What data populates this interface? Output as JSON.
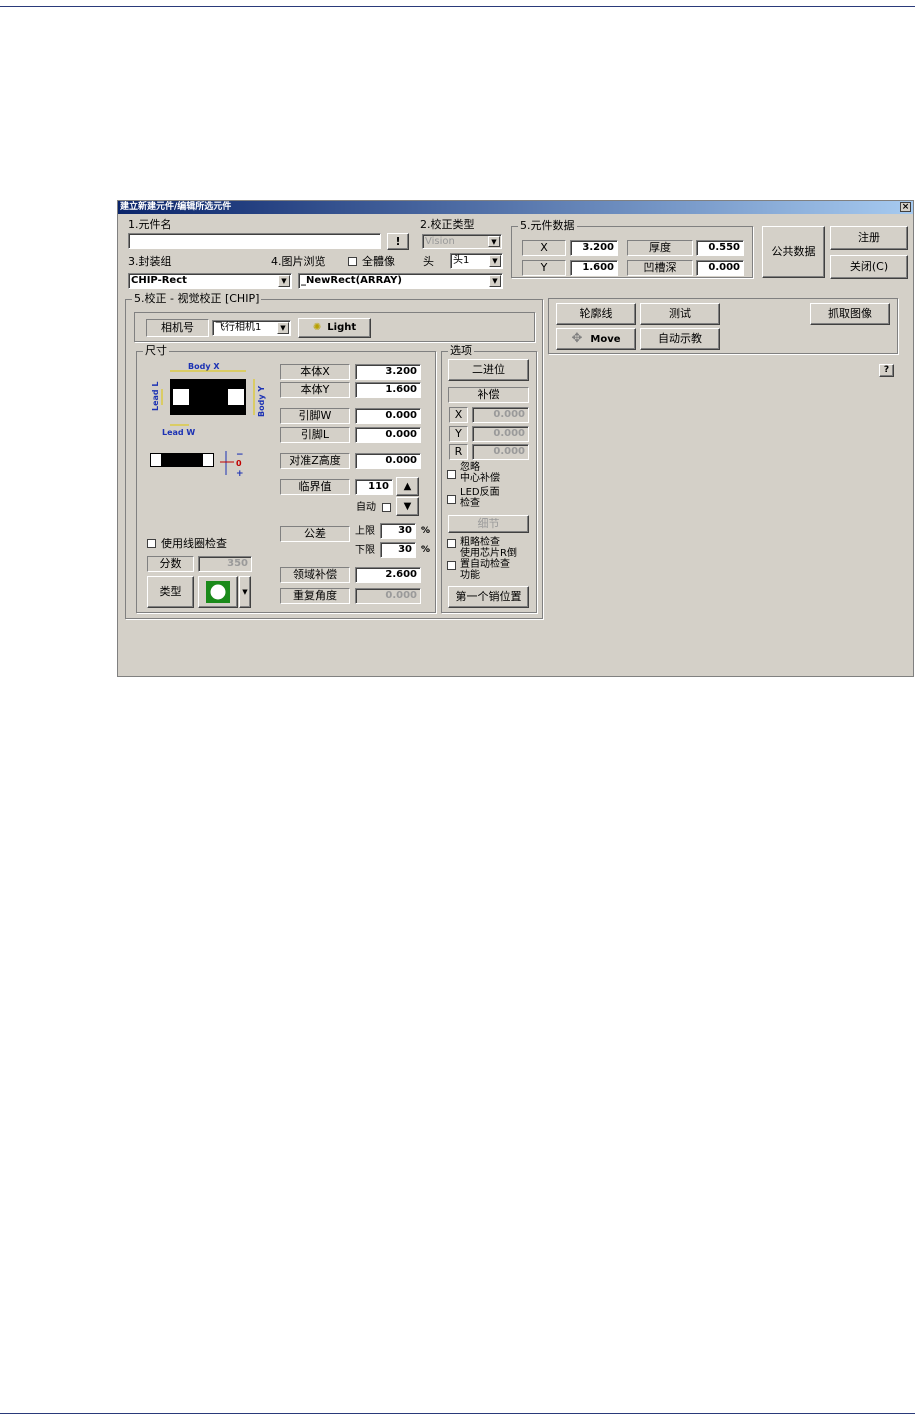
{
  "window": {
    "title": "建立新建元件/编辑所选元件",
    "close_glyph": "×"
  },
  "section1": {
    "label": "1.元件名",
    "value": "",
    "button_label": "!"
  },
  "section2": {
    "label": "2.校正类型",
    "value": "Vision"
  },
  "section3": {
    "label": "3.封装组",
    "value": "CHIP-Rect"
  },
  "section4": {
    "label": "4.图片浏览",
    "whole_body_label": "全體像",
    "head_label": "头",
    "head_value": "头1",
    "image_value": "_NewRect(ARRAY)"
  },
  "part_data": {
    "title": "5.元件数据",
    "x_label": "X",
    "x_value": "3.200",
    "y_label": "Y",
    "y_value": "1.600",
    "thickness_label": "厚度",
    "thickness_value": "0.550",
    "groove_label": "凹槽深",
    "groove_value": "0.000"
  },
  "buttons": {
    "common_data": "公共数据",
    "register": "注册",
    "close": "关闭(C)",
    "contour": "轮廓线",
    "test": "测试",
    "capture": "抓取图像",
    "move": "Move",
    "auto_teach": "自动示教",
    "help": "?"
  },
  "calib": {
    "title": "5.校正 - 视觉校正 [CHIP]",
    "camera_label": "相机号",
    "camera_value": "飞行相机1",
    "light_label": "Light"
  },
  "dimension": {
    "title": "尺寸",
    "diagram": {
      "body_x": "Body X",
      "body_y": "Body Y",
      "lead_l": "Lead L",
      "lead_w": "Lead W"
    },
    "body_x_label": "本体X",
    "body_x_value": "3.200",
    "body_y_label": "本体Y",
    "body_y_value": "1.600",
    "lead_w_label": "引脚W",
    "lead_w_value": "0.000",
    "lead_l_label": "引脚L",
    "lead_l_value": "0.000",
    "z_height_label": "对准Z高度",
    "z_height_value": "0.000",
    "threshold_label": "临界值",
    "threshold_value": "110",
    "auto_label": "自动",
    "tolerance_label": "公差",
    "upper_label": "上限",
    "upper_value": "30",
    "lower_label": "下限",
    "lower_value": "30",
    "percent": "%",
    "coil_check_label": "使用线圈检查",
    "score_label": "分数",
    "score_value": "350",
    "type_label": "类型",
    "domain_comp_label": "领域补偿",
    "domain_comp_value": "2.600",
    "repeat_angle_label": "重复角度",
    "repeat_angle_value": "0.000",
    "side_diagram": {
      "minus": "−",
      "zero": "0",
      "plus": "+"
    }
  },
  "options": {
    "title": "选项",
    "binary_label": "二进位",
    "compensation_label": "补偿",
    "x_label": "X",
    "x_value": "0.000",
    "y_label": "Y",
    "y_value": "0.000",
    "r_label": "R",
    "r_value": "0.000",
    "ignore_center_label": "忽略\n中心补偿",
    "led_check_label": "LED反面\n检查",
    "detail_label": "细节",
    "rough_check_label": "粗略检查",
    "chip_r_label": "使用芯片R倒\n置自动检查\n功能",
    "first_pin_label": "第一个销位置"
  }
}
